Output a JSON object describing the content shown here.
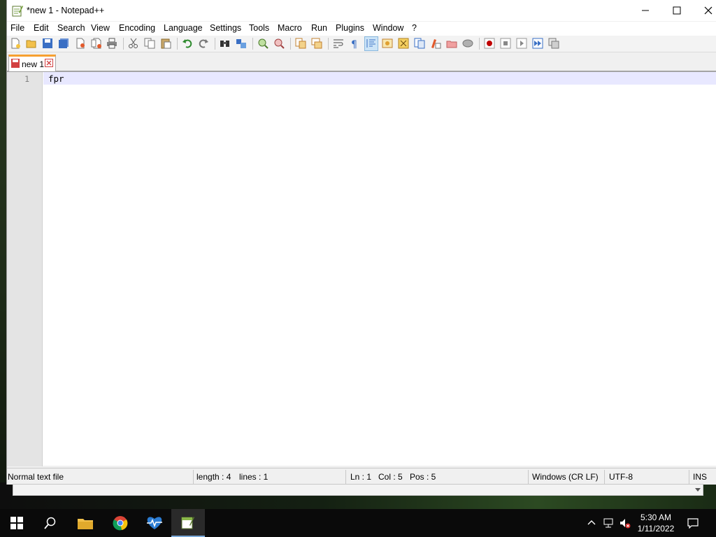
{
  "window": {
    "title": "*new 1 - Notepad++"
  },
  "menu": {
    "items": [
      "File",
      "Edit",
      "Search",
      "View",
      "Encoding",
      "Language",
      "Settings",
      "Tools",
      "Macro",
      "Run",
      "Plugins",
      "Window",
      "?"
    ]
  },
  "toolbar": {
    "icons": [
      "new-file-icon",
      "open-file-icon",
      "save-icon",
      "save-all-icon",
      "close-icon",
      "close-all-icon",
      "print-icon",
      "cut-icon",
      "copy-icon",
      "paste-icon",
      "undo-icon",
      "redo-icon",
      "find-icon",
      "replace-icon",
      "zoom-in-icon",
      "zoom-out-icon",
      "sync-vertical-icon",
      "sync-horizontal-icon",
      "word-wrap-icon",
      "show-all-chars-icon",
      "indent-guide-icon",
      "udl-icon",
      "doc-map-icon",
      "function-list-icon",
      "folder-workspace-icon",
      "monitoring-icon",
      "record-macro-icon",
      "stop-macro-icon",
      "play-macro-icon",
      "run-macro-multiple-icon",
      "save-macro-icon"
    ]
  },
  "tabs": [
    {
      "label": "new 1"
    }
  ],
  "editor": {
    "line_number": "1",
    "line_text": "fpr"
  },
  "status": {
    "file_type": "Normal text file",
    "length": "length : 4",
    "lines": "lines : 1",
    "ln": "Ln : 1",
    "col": "Col : 5",
    "pos": "Pos : 5",
    "eol": "Windows (CR LF)",
    "encoding": "UTF-8",
    "mode": "INS"
  },
  "taskbar": {
    "time": "5:30 AM",
    "date": "1/11/2022"
  },
  "colors": {
    "tab_accent": "#f7a030",
    "current_line": "#e8e8ff",
    "gutter": "#e4e4e4"
  }
}
